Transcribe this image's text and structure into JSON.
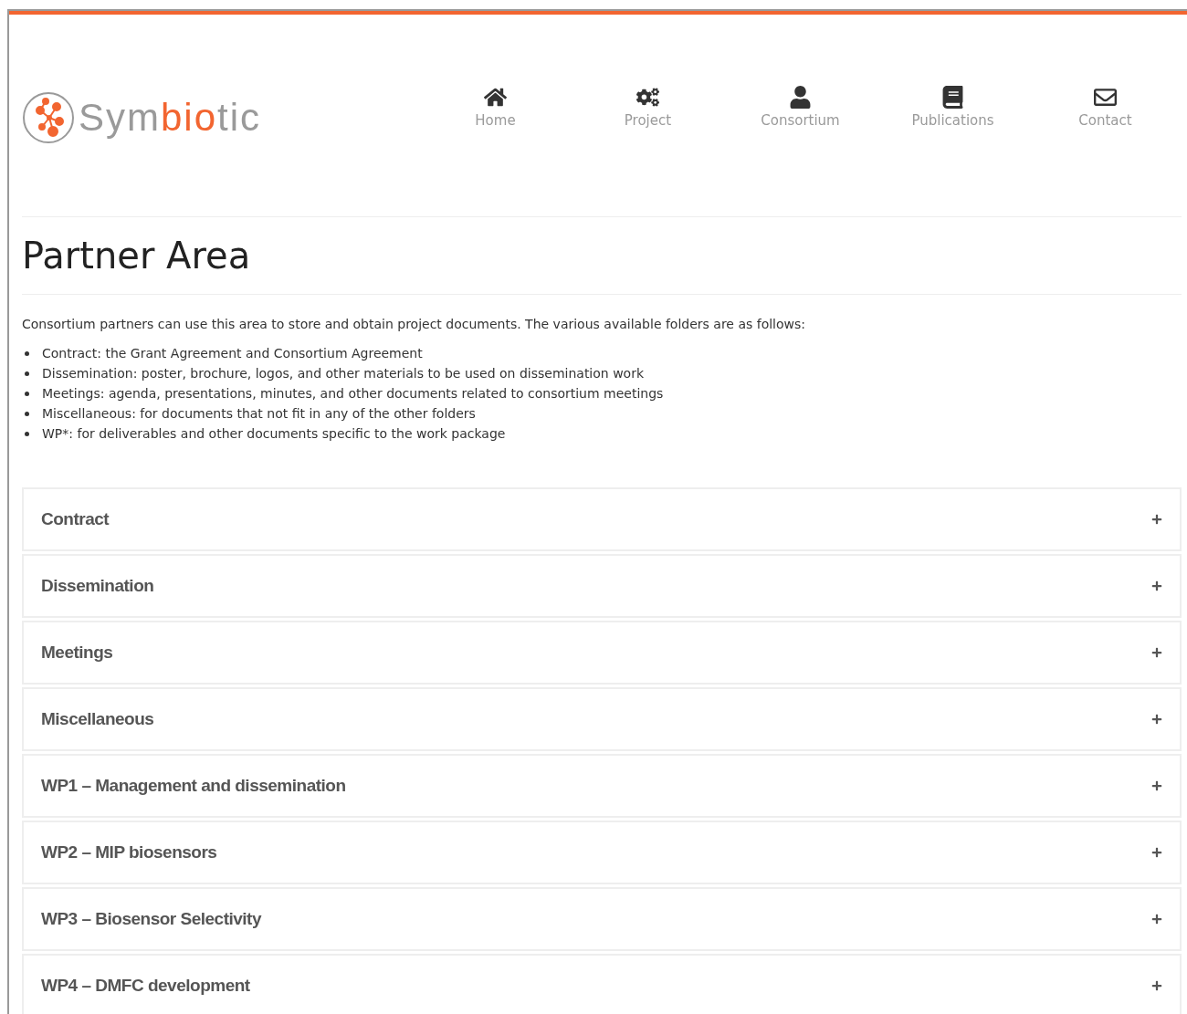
{
  "logo": {
    "parts": [
      {
        "text": "Sym",
        "accent": false
      },
      {
        "text": "bio",
        "accent": true
      },
      {
        "text": "tic",
        "accent": false
      }
    ]
  },
  "nav": [
    {
      "kind": "home",
      "label": "Home"
    },
    {
      "kind": "gears",
      "label": "Project"
    },
    {
      "kind": "person",
      "label": "Consortium"
    },
    {
      "kind": "book",
      "label": "Publications"
    },
    {
      "kind": "mail",
      "label": "Contact"
    }
  ],
  "title": "Partner Area",
  "intro": "Consortium partners can use this area to store and obtain project documents. The various available folders are as follows:",
  "folders_list": [
    "Contract: the Grant Agreement and Consortium Agreement",
    "Dissemination: poster, brochure, logos, and other materials to be used on dissemination work",
    "Meetings: agenda, presentations, minutes, and other documents related to consortium meetings",
    "Miscellaneous: for documents that not fit in any of the other folders",
    "WP*: for deliverables and other documents specific to the work package"
  ],
  "accordion": [
    {
      "title": "Contract",
      "expanded": false
    },
    {
      "title": "Dissemination",
      "expanded": false
    },
    {
      "title": "Meetings",
      "expanded": false
    },
    {
      "title": "Miscellaneous",
      "expanded": false
    },
    {
      "title": "WP1 – Management and dissemination",
      "expanded": false
    },
    {
      "title": "WP2 – MIP biosensors",
      "expanded": false
    },
    {
      "title": "WP3 – Biosensor Selectivity",
      "expanded": false
    },
    {
      "title": "WP4 – DMFC development",
      "expanded": false
    }
  ]
}
